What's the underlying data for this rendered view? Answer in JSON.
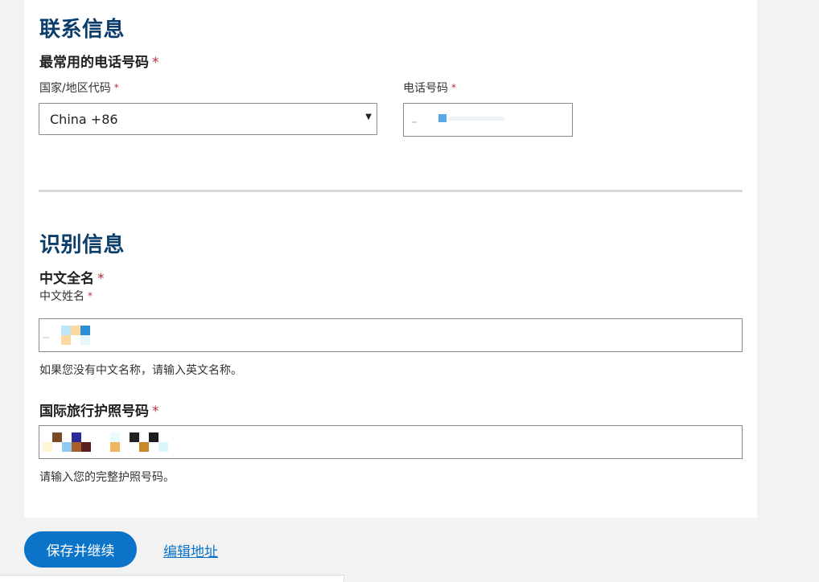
{
  "contact": {
    "section_title": "联系信息",
    "phone_title": "最常用的电话号码",
    "required_mark": "*",
    "country_code_label": "国家/地区代码",
    "country_code_value": "China +86",
    "phone_label": "电话号码"
  },
  "identity": {
    "section_title": "识别信息",
    "chinese_name_title": "中文全名",
    "chinese_name_label": "中文姓名",
    "chinese_name_help": "如果您没有中文名称，请输入英文名称。",
    "passport_title": "国际旅行护照号码",
    "passport_help": "请输入您的完整护照号码。"
  },
  "actions": {
    "save_continue": "保存并继续",
    "edit_address": "编辑地址"
  },
  "colors": {
    "heading": "#0b3d6b",
    "primary": "#0b74c8",
    "required": "#b0303b"
  },
  "icons": {
    "select_caret": "triangle-down"
  }
}
